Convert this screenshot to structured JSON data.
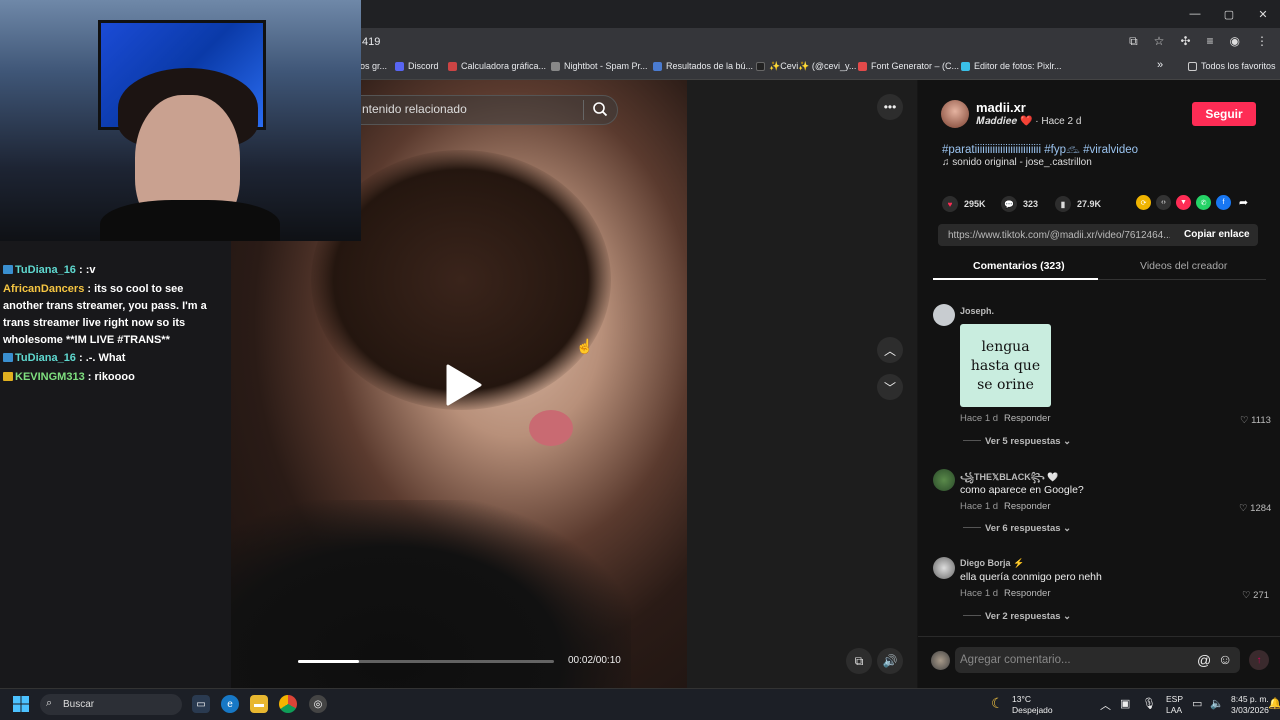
{
  "window": {
    "controls": [
      "—",
      "▢",
      "✕"
    ]
  },
  "address": {
    "url_visible": "419",
    "icons": [
      "cast-icon",
      "star-icon",
      "extensions-icon",
      "tab-search-icon",
      "profile-icon",
      "menu-icon"
    ]
  },
  "bookmarks": [
    {
      "label": "os gr...",
      "color": "#8ab4f8"
    },
    {
      "label": "Discord",
      "color": "#5865f2"
    },
    {
      "label": "Calculadora gráfica...",
      "color": "#cc4444"
    },
    {
      "label": "Nightbot - Spam Pr...",
      "color": "#888888"
    },
    {
      "label": "Resultados de la bú...",
      "color": "#4a7bd0"
    },
    {
      "label": "✨Cevi✨ (@cevi_y...",
      "color": "#222222"
    },
    {
      "label": "Font Generator – (C...",
      "color": "#e24a4a"
    },
    {
      "label": "Editor de fotos: Pixlr...",
      "color": "#3ac0e8"
    }
  ],
  "bookmarks_more": "»",
  "all_bookmarks": "Todos los favoritos",
  "video": {
    "search_placeholder": "ntenido relacionado",
    "time": "00:02/00:10",
    "progress": 0.24
  },
  "chat": [
    {
      "user": "TuDiana_16",
      "msg": " : :v",
      "cls": "user1"
    },
    {
      "user": "AfricanDancers",
      "msg": " : its so cool to see another trans streamer, you pass. I'm a trans streamer live right now so its wholesome **IM LIVE #TRANS**",
      "cls": "user2"
    },
    {
      "user": "TuDiana_16",
      "msg": " : .-. What",
      "cls": "user1"
    },
    {
      "user": "KEVINGM313",
      "msg": " : rikoooo",
      "cls": "user3"
    }
  ],
  "author": {
    "name": "madii.xr",
    "display": "𝑴𝒂𝒅𝒅𝒊𝒆𝒆 ❤️",
    "time": " · Hace 2 d",
    "follow": "Seguir"
  },
  "caption": {
    "hashtags": "#paratiiiiiiiiiiiiiiiiiiiiiiiiii #fyp𓃺 #viralvideo",
    "sound": "♫  sonido original - jose_.castrillon"
  },
  "stats": {
    "likes": "295K",
    "comments": "323",
    "saves": "27.9K"
  },
  "link": {
    "url": "https://www.tiktok.com/@madii.xr/video/7612464...",
    "copy": "Copiar enlace"
  },
  "tabs": {
    "comments": "Comentarios (323)",
    "creator_videos": "Videos del creador"
  },
  "comments": [
    {
      "user": "Joseph.",
      "text": "",
      "sticker": [
        "lengua",
        "hasta que",
        "se orine"
      ],
      "time": "Hace 1 d",
      "reply": "Responder",
      "likes": "1113",
      "replies": "Ver 5 respuestas ⌄"
    },
    {
      "user": "꧁THE𝕏BLACK꧂ 🤍",
      "text": "como aparece en Google?",
      "time": "Hace 1 d",
      "reply": "Responder",
      "likes": "1284",
      "replies": "Ver 6 respuestas ⌄"
    },
    {
      "user": "Diego Borja ⚡",
      "text": "ella quería conmigo pero nehh",
      "time": "Hace 1 d",
      "reply": "Responder",
      "likes": "271",
      "replies": "Ver 2 respuestas ⌄"
    }
  ],
  "comment_input": {
    "placeholder": "Agregar comentario..."
  },
  "taskbar": {
    "search": "Buscar",
    "weather_temp": "13°C",
    "weather_desc": "Despejado",
    "lang1": "ESP",
    "lang2": "LAA",
    "time": "8:45 p. m.",
    "date": "3/03/2026"
  },
  "colors": {
    "accent": "#fe2c55",
    "hashtag": "#9bc4f0"
  }
}
